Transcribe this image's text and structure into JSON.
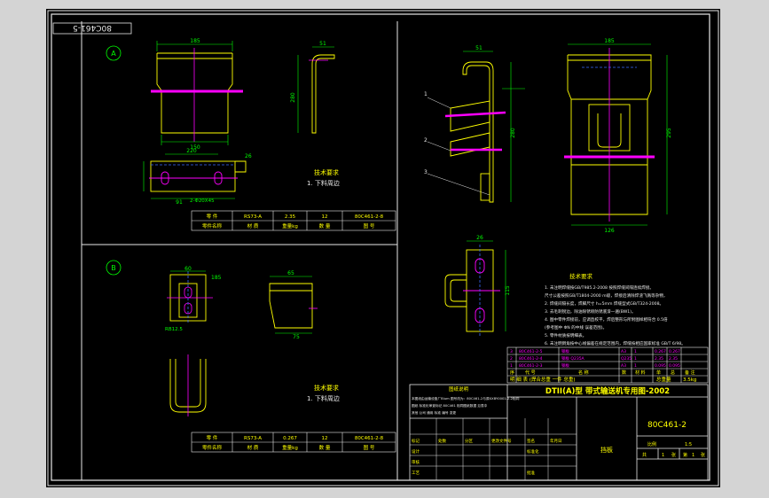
{
  "colors": {
    "frame": "#e8e8e8",
    "page": "#d4d4d4",
    "bg": "#000000",
    "yellow": "#ffff00",
    "magenta": "#ff00ff",
    "cyan": "#00ffff",
    "white": "#ffffff",
    "green": "#00ff00",
    "blue": "#3a6bff"
  },
  "drawing_no_rotated": "80C461-5",
  "view_a": {
    "label": "A",
    "dims": [
      "185",
      "150",
      "51",
      "280",
      "220",
      "91",
      "2-Φ20X45",
      "26"
    ],
    "req_title": "技术要求",
    "req_line": "1. 下料周边",
    "table_row1": [
      "零 件",
      "RS73-A",
      "2.35",
      "12",
      "80C461-2-8"
    ],
    "table_row2": [
      "零件名称",
      "材 质",
      "重量kg",
      "数 量",
      "图 号"
    ]
  },
  "view_b": {
    "label": "B",
    "dims": [
      "60",
      "185",
      "RB12.5",
      "65",
      "75"
    ],
    "req_title": "技术要求",
    "req_line": "1. 下料周边",
    "table_row1": [
      "零 件",
      "RS73-A",
      "0.267",
      "12",
      "80C461-2-8"
    ],
    "table_row2": [
      "零件名称",
      "材 质",
      "重量kg",
      "数 量",
      "图 号"
    ]
  },
  "right_dims": [
    "51",
    "185",
    "295",
    "280",
    "126",
    "26",
    "115"
  ],
  "tech_notes": {
    "title": "技术要求",
    "lines": [
      "1. 未注明焊缝按GB/T985.2-2008 按照焊缝间隔连续焊接。",
      "尺寸公差按照GB/T1804-2000 m级，焊接后清除焊渣飞溅等杂物，",
      "2. 焊缝间隔长度，焊脚尺寸 h=5mm 焊缝型式GB/T324-2008。",
      "3. 去毛刺锐边，除油除锈喷防锈底漆一遍(BW1)。",
      "4. 图中零件焊接前，应调直校平，焊后整形与所附图样相符合 0.5倍",
      "(参考图中 ΦN 的中线 误差范围)。",
      "5. 零件材质按明细表。",
      "6. 未注明倒角按中心线偏差在规定范围内，焊缝按相应国家标准 GB/T 6/98。"
    ]
  },
  "bom": {
    "rows": [
      [
        "3",
        "80C461-2-5",
        "钢板",
        "A3",
        "1",
        "0.267",
        "0.267"
      ],
      [
        "2",
        "80C461-2-4",
        "钢板 Q235A",
        "Q235",
        "1",
        "2.35",
        "2.35"
      ],
      [
        "1",
        "80C461-2-3",
        "钢板",
        "A3",
        "1",
        "0.095",
        "0.095"
      ]
    ],
    "header": [
      "序",
      "代 号",
      "名 称",
      "数",
      "材 料",
      "单",
      "总",
      "备 注"
    ]
  },
  "title_block": {
    "weight_line": "明  细  表   (焊合总重  一件  总重)",
    "weight_label": "总重量",
    "weight_value": "3.5kg",
    "title": "DTII(A)型  带式输送机专用图-2002",
    "drawing_no": "80C461-2",
    "part_name": "挡板",
    "scale_label": "比例",
    "scale": "1:5",
    "sheet_labels": [
      "共",
      "张",
      "第",
      "张"
    ],
    "sheet_values": [
      "1",
      "1"
    ],
    "stamp_title": "图纸说明",
    "stamp_lines": [
      "本图纸由运输设备厂Blum 图号改为：80C461-2与原XXBY0001-2-2相同",
      "图纸 标准化审查标记 80C461 相同图纸数据 见表中",
      "其他 公司 通用 标准 编号 变更"
    ],
    "left_rows": [
      [
        "标记",
        "处数",
        "分区",
        "更改文件号",
        "签名",
        "年月日"
      ],
      [
        "设计",
        "",
        "",
        "标准化",
        "",
        ""
      ],
      [
        "审核",
        "",
        "",
        "",
        "",
        ""
      ],
      [
        "工艺",
        "",
        "",
        "批准",
        "",
        ""
      ]
    ]
  }
}
